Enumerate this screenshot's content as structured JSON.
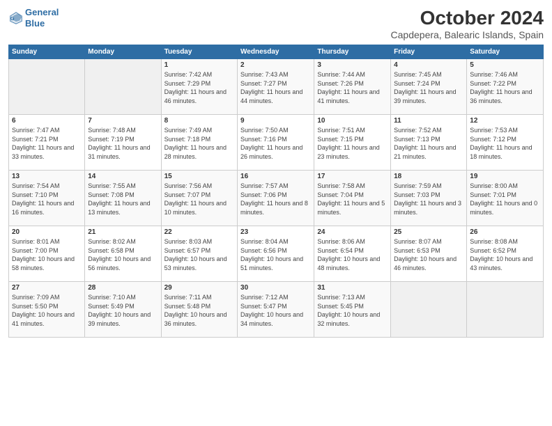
{
  "header": {
    "logo_line1": "General",
    "logo_line2": "Blue",
    "main_title": "October 2024",
    "sub_title": "Capdepera, Balearic Islands, Spain"
  },
  "days_of_week": [
    "Sunday",
    "Monday",
    "Tuesday",
    "Wednesday",
    "Thursday",
    "Friday",
    "Saturday"
  ],
  "weeks": [
    [
      {
        "day": "",
        "info": ""
      },
      {
        "day": "",
        "info": ""
      },
      {
        "day": "1",
        "info": "Sunrise: 7:42 AM\nSunset: 7:29 PM\nDaylight: 11 hours and 46 minutes."
      },
      {
        "day": "2",
        "info": "Sunrise: 7:43 AM\nSunset: 7:27 PM\nDaylight: 11 hours and 44 minutes."
      },
      {
        "day": "3",
        "info": "Sunrise: 7:44 AM\nSunset: 7:26 PM\nDaylight: 11 hours and 41 minutes."
      },
      {
        "day": "4",
        "info": "Sunrise: 7:45 AM\nSunset: 7:24 PM\nDaylight: 11 hours and 39 minutes."
      },
      {
        "day": "5",
        "info": "Sunrise: 7:46 AM\nSunset: 7:22 PM\nDaylight: 11 hours and 36 minutes."
      }
    ],
    [
      {
        "day": "6",
        "info": "Sunrise: 7:47 AM\nSunset: 7:21 PM\nDaylight: 11 hours and 33 minutes."
      },
      {
        "day": "7",
        "info": "Sunrise: 7:48 AM\nSunset: 7:19 PM\nDaylight: 11 hours and 31 minutes."
      },
      {
        "day": "8",
        "info": "Sunrise: 7:49 AM\nSunset: 7:18 PM\nDaylight: 11 hours and 28 minutes."
      },
      {
        "day": "9",
        "info": "Sunrise: 7:50 AM\nSunset: 7:16 PM\nDaylight: 11 hours and 26 minutes."
      },
      {
        "day": "10",
        "info": "Sunrise: 7:51 AM\nSunset: 7:15 PM\nDaylight: 11 hours and 23 minutes."
      },
      {
        "day": "11",
        "info": "Sunrise: 7:52 AM\nSunset: 7:13 PM\nDaylight: 11 hours and 21 minutes."
      },
      {
        "day": "12",
        "info": "Sunrise: 7:53 AM\nSunset: 7:12 PM\nDaylight: 11 hours and 18 minutes."
      }
    ],
    [
      {
        "day": "13",
        "info": "Sunrise: 7:54 AM\nSunset: 7:10 PM\nDaylight: 11 hours and 16 minutes."
      },
      {
        "day": "14",
        "info": "Sunrise: 7:55 AM\nSunset: 7:08 PM\nDaylight: 11 hours and 13 minutes."
      },
      {
        "day": "15",
        "info": "Sunrise: 7:56 AM\nSunset: 7:07 PM\nDaylight: 11 hours and 10 minutes."
      },
      {
        "day": "16",
        "info": "Sunrise: 7:57 AM\nSunset: 7:06 PM\nDaylight: 11 hours and 8 minutes."
      },
      {
        "day": "17",
        "info": "Sunrise: 7:58 AM\nSunset: 7:04 PM\nDaylight: 11 hours and 5 minutes."
      },
      {
        "day": "18",
        "info": "Sunrise: 7:59 AM\nSunset: 7:03 PM\nDaylight: 11 hours and 3 minutes."
      },
      {
        "day": "19",
        "info": "Sunrise: 8:00 AM\nSunset: 7:01 PM\nDaylight: 11 hours and 0 minutes."
      }
    ],
    [
      {
        "day": "20",
        "info": "Sunrise: 8:01 AM\nSunset: 7:00 PM\nDaylight: 10 hours and 58 minutes."
      },
      {
        "day": "21",
        "info": "Sunrise: 8:02 AM\nSunset: 6:58 PM\nDaylight: 10 hours and 56 minutes."
      },
      {
        "day": "22",
        "info": "Sunrise: 8:03 AM\nSunset: 6:57 PM\nDaylight: 10 hours and 53 minutes."
      },
      {
        "day": "23",
        "info": "Sunrise: 8:04 AM\nSunset: 6:56 PM\nDaylight: 10 hours and 51 minutes."
      },
      {
        "day": "24",
        "info": "Sunrise: 8:06 AM\nSunset: 6:54 PM\nDaylight: 10 hours and 48 minutes."
      },
      {
        "day": "25",
        "info": "Sunrise: 8:07 AM\nSunset: 6:53 PM\nDaylight: 10 hours and 46 minutes."
      },
      {
        "day": "26",
        "info": "Sunrise: 8:08 AM\nSunset: 6:52 PM\nDaylight: 10 hours and 43 minutes."
      }
    ],
    [
      {
        "day": "27",
        "info": "Sunrise: 7:09 AM\nSunset: 5:50 PM\nDaylight: 10 hours and 41 minutes."
      },
      {
        "day": "28",
        "info": "Sunrise: 7:10 AM\nSunset: 5:49 PM\nDaylight: 10 hours and 39 minutes."
      },
      {
        "day": "29",
        "info": "Sunrise: 7:11 AM\nSunset: 5:48 PM\nDaylight: 10 hours and 36 minutes."
      },
      {
        "day": "30",
        "info": "Sunrise: 7:12 AM\nSunset: 5:47 PM\nDaylight: 10 hours and 34 minutes."
      },
      {
        "day": "31",
        "info": "Sunrise: 7:13 AM\nSunset: 5:45 PM\nDaylight: 10 hours and 32 minutes."
      },
      {
        "day": "",
        "info": ""
      },
      {
        "day": "",
        "info": ""
      }
    ]
  ]
}
